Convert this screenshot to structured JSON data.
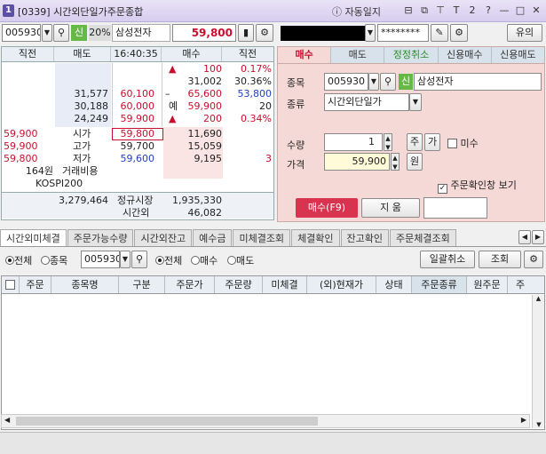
{
  "window": {
    "number": "1",
    "title": "[0339] 시간외단일가주문종합",
    "autosave_label": "자동일지",
    "buttons": [
      "⊟",
      "⧉",
      "⊤",
      "T",
      "2",
      "?",
      "—",
      "□",
      "✕"
    ]
  },
  "toolbar": {
    "code": "005930",
    "credit_badge": "신",
    "margin": "20%",
    "stock_name": "삼성전자",
    "price": "59,800",
    "account": "",
    "password": "********",
    "notice_button": "유의"
  },
  "quote": {
    "headers": [
      "직전",
      "매도",
      "16:40:35",
      "매수",
      "직전"
    ],
    "ask_rows": [
      {
        "prev": "",
        "ask": "",
        "arrow": "▲",
        "qty": "100",
        "pct": "0.17%"
      },
      {
        "prev": "",
        "ask": "",
        "arrow": "",
        "qty": "31,002",
        "pct": "30.36%"
      },
      {
        "prev": "31,577",
        "ask": "60,100",
        "arrow": "–",
        "qty": "65,600",
        "pct": "53,800"
      },
      {
        "prev": "30,188",
        "ask": "60,000",
        "arrow": "예",
        "qty": "59,900",
        "pct": "20"
      },
      {
        "prev": "24,249",
        "ask": "59,900",
        "arrow": "▲",
        "qty": "200",
        "pct": "0.34%"
      }
    ],
    "info_rows": [
      {
        "left": "59,900",
        "label": "시가",
        "price": "59,800",
        "bid": "11,690",
        "prev": ""
      },
      {
        "left": "59,900",
        "label": "고가",
        "price": "59,700",
        "bid": "15,059",
        "prev": ""
      },
      {
        "left": "59,800",
        "label": "저가",
        "price": "59,600",
        "bid": "9,195",
        "prev": "3"
      }
    ],
    "fee_row": {
      "left": "164원",
      "label": "거래비용"
    },
    "kospi_row": {
      "left": "KOSPI200"
    },
    "total_row": {
      "left": "3,279,464",
      "label": "정규시장",
      "value": "1,935,330"
    },
    "after_row": {
      "label": "시간외",
      "value": "46,082"
    }
  },
  "order": {
    "tabs": [
      "매수",
      "매도",
      "정정취소",
      "신용매수",
      "신용매도"
    ],
    "code_label": "종목",
    "code": "005930",
    "credit": "신",
    "stock_name": "삼성전자",
    "type_label": "종류",
    "type_value": "시간외단일가",
    "qty_label": "수량",
    "qty_value": "1",
    "qty_btn1": "주",
    "qty_btn2": "가",
    "misu_label": "미수",
    "price_label": "가격",
    "price_value": "59,900",
    "price_unit": "원",
    "confirm_label": "주문확인창 보기",
    "buy_button": "매수(F9)",
    "clear_button": "지 움"
  },
  "bottom_tabs": [
    "시간외미체결",
    "주문가능수량",
    "시간외잔고",
    "예수금",
    "미체결조회",
    "체결확인",
    "잔고확인",
    "주문체결조회"
  ],
  "filter": {
    "all1": "전체",
    "item": "종목",
    "code": "005930",
    "all2": "전체",
    "buy": "매수",
    "sell": "매도",
    "cancel_all": "일괄취소",
    "query": "조회"
  },
  "columns": [
    "주문",
    "종목명",
    "구분",
    "주문가",
    "주문량",
    "미체결",
    "(외)현재가",
    "상태",
    "주문종류",
    "원주문",
    "주"
  ]
}
